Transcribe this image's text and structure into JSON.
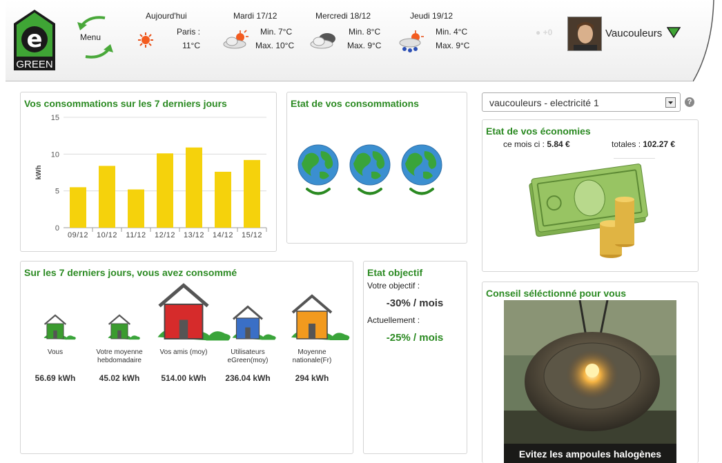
{
  "header": {
    "logo_text": "GREEN",
    "menu_label": "Menu",
    "weather": [
      {
        "day": "Aujourd'hui",
        "line1": "Paris :",
        "line2": "11°C",
        "icon": "sun-icon"
      },
      {
        "day": "Mardi 17/12",
        "line1": "Min. 7°C",
        "line2": "Max. 10°C",
        "icon": "sun-cloud-icon"
      },
      {
        "day": "Mercredi 18/12",
        "line1": "Min. 8°C",
        "line2": "Max. 9°C",
        "icon": "cloud-icon"
      },
      {
        "day": "Jeudi 19/12",
        "line1": "Min. 4°C",
        "line2": "Max. 9°C",
        "icon": "rain-sun-icon"
      }
    ],
    "friends_count": "+0",
    "username": "Vaucouleurs"
  },
  "consumption_chart": {
    "title": "Vos consommations sur les 7 derniers jours"
  },
  "chart_data": {
    "type": "bar",
    "categories": [
      "09/12",
      "10/12",
      "11/12",
      "12/12",
      "13/12",
      "14/12",
      "15/12"
    ],
    "values": [
      5.5,
      8.4,
      5.2,
      10.1,
      10.9,
      7.6,
      9.2
    ],
    "ylabel": "kWh",
    "xlabel": "",
    "ylim": [
      0,
      15
    ],
    "yticks": [
      "0",
      "5",
      "10",
      "15"
    ],
    "bar_color": "#f5d20c",
    "grid": true
  },
  "state_panel": {
    "title": "Etat de vos consommations"
  },
  "compare_panel": {
    "title": "Sur les 7 derniers jours, vous avez consommé",
    "items": [
      {
        "name": "Vous",
        "value": "56.69 kWh",
        "color": "#3b9b2f"
      },
      {
        "name": "Votre moyenne hebdomadaire",
        "value": "45.02 kWh",
        "color": "#3b9b2f"
      },
      {
        "name": "Vos amis (moy)",
        "value": "514.00 kWh",
        "color": "#d62b2b"
      },
      {
        "name": "Utilisateurs eGreen(moy)",
        "value": "236.04 kWh",
        "color": "#3a6fc6"
      },
      {
        "name": "Moyenne nationale(Fr)",
        "value": "294 kWh",
        "color": "#f29a1e"
      }
    ]
  },
  "goal_panel": {
    "title": "Etat objectif",
    "goal_label": "Votre objectif :",
    "goal_value": "-30% / mois",
    "current_label": "Actuellement :",
    "current_value": "-25% / mois",
    "current_color": "#2b8a22"
  },
  "meter_select": {
    "value": "vaucouleurs - electricité 1"
  },
  "savings_panel": {
    "title": "Etat de vos économies",
    "month_label": "ce mois ci :",
    "month_value": "5.84 €",
    "total_label": "totales :",
    "total_value": "102.27 €"
  },
  "tip_panel": {
    "title": "Conseil séléctionné pour vous",
    "caption": "Evitez les ampoules halogènes"
  },
  "colors": {
    "accent_green": "#2b8a22",
    "bar_yellow": "#f5d20c"
  }
}
